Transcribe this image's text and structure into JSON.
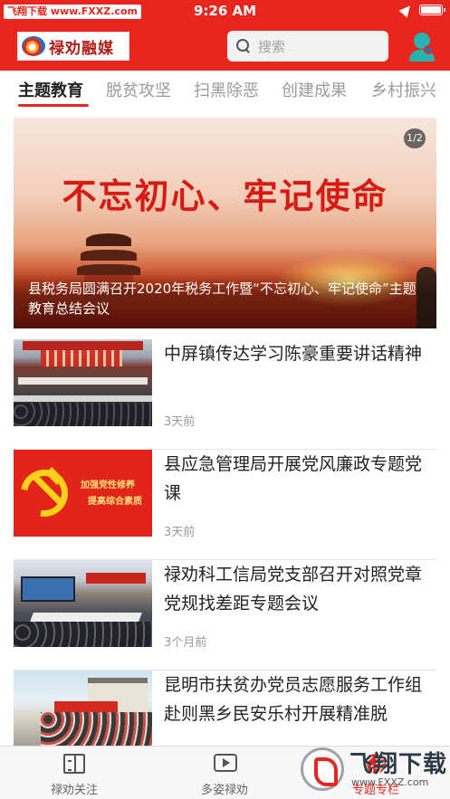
{
  "status_bar": {
    "watermark": "飞翔下载 www.FXXZ.com",
    "time": "9:26 AM"
  },
  "header": {
    "logo_text": "禄劝融媒",
    "search_placeholder": "搜索"
  },
  "tabs": [
    {
      "label": "主题教育",
      "active": true
    },
    {
      "label": "脱贫攻坚",
      "active": false
    },
    {
      "label": "扫黑除恶",
      "active": false
    },
    {
      "label": "创建成果",
      "active": false
    },
    {
      "label": "乡村振兴",
      "active": false
    }
  ],
  "banner": {
    "slogan": "不忘初心、牢记使命",
    "pagination": "1/2",
    "caption": "县税务局圆满召开2020年税务工作暨“不忘初心、牢记使命”主题教育总结会议"
  },
  "news": [
    {
      "title": "中屏镇传达学习陈豪重要讲话精神",
      "time": "3天前"
    },
    {
      "title": "县应急管理局开展党风廉政专题党课",
      "time": "3天前",
      "thumb_text": [
        "加强党性修养",
        "提高综合素质"
      ]
    },
    {
      "title": "禄劝科工信局党支部召开对照党章党规找差距专题会议",
      "time": "3个月前"
    },
    {
      "title": "昆明市扶贫办党员志愿服务工作组赴则黑乡民安乐村开展精准脱",
      "time": ""
    }
  ],
  "tabbar": [
    {
      "label": "禄劝关注",
      "icon": "book-icon"
    },
    {
      "label": "多姿禄劝",
      "icon": "video-icon"
    },
    {
      "label": "专题专栏",
      "icon": "topic-icon",
      "active": true
    }
  ],
  "watermark_br": {
    "text": "飞翔下载",
    "url": "www.FXXZ.com"
  },
  "colors": {
    "brand_red": "#e8261e",
    "tab_inactive": "#9a9a9a",
    "text_primary": "#222222"
  }
}
